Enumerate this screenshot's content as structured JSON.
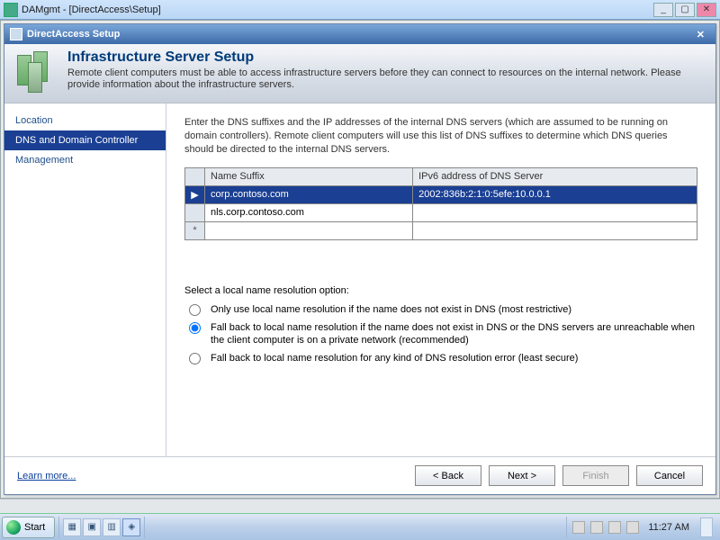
{
  "app": {
    "title": "DAMgmt - [DirectAccess\\Setup]"
  },
  "wizard": {
    "title": "DirectAccess Setup",
    "heading": "Infrastructure Server Setup",
    "subheading": "Remote client computers must be able to access infrastructure servers before they can connect to resources on the internal network. Please provide information about the infrastructure servers.",
    "nav": [
      "Location",
      "DNS and Domain Controller",
      "Management"
    ],
    "instructions": "Enter the DNS suffixes and the IP addresses of the internal DNS servers (which are assumed to be running on domain controllers). Remote client computers will use this list of DNS suffixes to determine which DNS queries should be directed to the internal DNS servers.",
    "table": {
      "columns": [
        "Name Suffix",
        "IPv6 address of DNS Server"
      ],
      "rows": [
        {
          "suffix": "corp.contoso.com",
          "ipv6": "2002:836b:2:1:0:5efe:10.0.0.1"
        },
        {
          "suffix": "nls.corp.contoso.com",
          "ipv6": ""
        }
      ]
    },
    "radio": {
      "label": "Select a local name resolution option:",
      "options": [
        "Only use local name resolution if the name does not exist in DNS (most restrictive)",
        "Fall back to local name resolution if the name does not exist in DNS or the DNS servers are unreachable when the client computer is on a private network (recommended)",
        "Fall back to local name resolution for any kind of DNS resolution error (least secure)"
      ]
    },
    "footer": {
      "learn": "Learn more...",
      "back": "< Back",
      "next": "Next >",
      "finish": "Finish",
      "cancel": "Cancel"
    }
  },
  "taskbar": {
    "start": "Start",
    "time": "11:27 AM"
  }
}
